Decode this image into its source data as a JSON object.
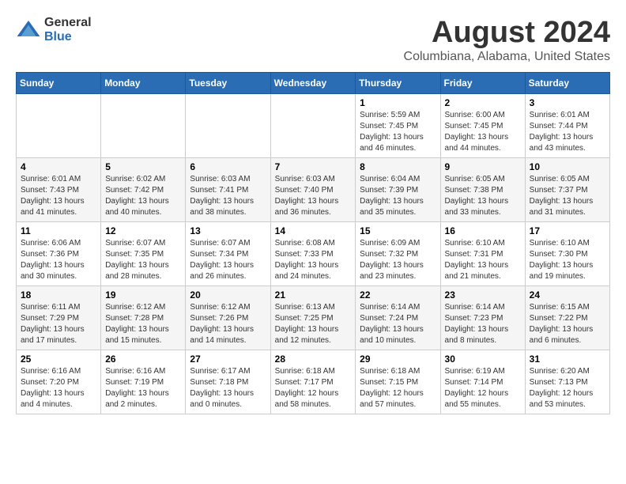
{
  "logo": {
    "general": "General",
    "blue": "Blue"
  },
  "title": "August 2024",
  "subtitle": "Columbiana, Alabama, United States",
  "days_of_week": [
    "Sunday",
    "Monday",
    "Tuesday",
    "Wednesday",
    "Thursday",
    "Friday",
    "Saturday"
  ],
  "weeks": [
    [
      {
        "day": "",
        "info": ""
      },
      {
        "day": "",
        "info": ""
      },
      {
        "day": "",
        "info": ""
      },
      {
        "day": "",
        "info": ""
      },
      {
        "day": "1",
        "sunrise": "5:59 AM",
        "sunset": "7:45 PM",
        "daylight": "13 hours and 46 minutes."
      },
      {
        "day": "2",
        "sunrise": "6:00 AM",
        "sunset": "7:45 PM",
        "daylight": "13 hours and 44 minutes."
      },
      {
        "day": "3",
        "sunrise": "6:01 AM",
        "sunset": "7:44 PM",
        "daylight": "13 hours and 43 minutes."
      }
    ],
    [
      {
        "day": "4",
        "sunrise": "6:01 AM",
        "sunset": "7:43 PM",
        "daylight": "13 hours and 41 minutes."
      },
      {
        "day": "5",
        "sunrise": "6:02 AM",
        "sunset": "7:42 PM",
        "daylight": "13 hours and 40 minutes."
      },
      {
        "day": "6",
        "sunrise": "6:03 AM",
        "sunset": "7:41 PM",
        "daylight": "13 hours and 38 minutes."
      },
      {
        "day": "7",
        "sunrise": "6:03 AM",
        "sunset": "7:40 PM",
        "daylight": "13 hours and 36 minutes."
      },
      {
        "day": "8",
        "sunrise": "6:04 AM",
        "sunset": "7:39 PM",
        "daylight": "13 hours and 35 minutes."
      },
      {
        "day": "9",
        "sunrise": "6:05 AM",
        "sunset": "7:38 PM",
        "daylight": "13 hours and 33 minutes."
      },
      {
        "day": "10",
        "sunrise": "6:05 AM",
        "sunset": "7:37 PM",
        "daylight": "13 hours and 31 minutes."
      }
    ],
    [
      {
        "day": "11",
        "sunrise": "6:06 AM",
        "sunset": "7:36 PM",
        "daylight": "13 hours and 30 minutes."
      },
      {
        "day": "12",
        "sunrise": "6:07 AM",
        "sunset": "7:35 PM",
        "daylight": "13 hours and 28 minutes."
      },
      {
        "day": "13",
        "sunrise": "6:07 AM",
        "sunset": "7:34 PM",
        "daylight": "13 hours and 26 minutes."
      },
      {
        "day": "14",
        "sunrise": "6:08 AM",
        "sunset": "7:33 PM",
        "daylight": "13 hours and 24 minutes."
      },
      {
        "day": "15",
        "sunrise": "6:09 AM",
        "sunset": "7:32 PM",
        "daylight": "13 hours and 23 minutes."
      },
      {
        "day": "16",
        "sunrise": "6:10 AM",
        "sunset": "7:31 PM",
        "daylight": "13 hours and 21 minutes."
      },
      {
        "day": "17",
        "sunrise": "6:10 AM",
        "sunset": "7:30 PM",
        "daylight": "13 hours and 19 minutes."
      }
    ],
    [
      {
        "day": "18",
        "sunrise": "6:11 AM",
        "sunset": "7:29 PM",
        "daylight": "13 hours and 17 minutes."
      },
      {
        "day": "19",
        "sunrise": "6:12 AM",
        "sunset": "7:28 PM",
        "daylight": "13 hours and 15 minutes."
      },
      {
        "day": "20",
        "sunrise": "6:12 AM",
        "sunset": "7:26 PM",
        "daylight": "13 hours and 14 minutes."
      },
      {
        "day": "21",
        "sunrise": "6:13 AM",
        "sunset": "7:25 PM",
        "daylight": "13 hours and 12 minutes."
      },
      {
        "day": "22",
        "sunrise": "6:14 AM",
        "sunset": "7:24 PM",
        "daylight": "13 hours and 10 minutes."
      },
      {
        "day": "23",
        "sunrise": "6:14 AM",
        "sunset": "7:23 PM",
        "daylight": "13 hours and 8 minutes."
      },
      {
        "day": "24",
        "sunrise": "6:15 AM",
        "sunset": "7:22 PM",
        "daylight": "13 hours and 6 minutes."
      }
    ],
    [
      {
        "day": "25",
        "sunrise": "6:16 AM",
        "sunset": "7:20 PM",
        "daylight": "13 hours and 4 minutes."
      },
      {
        "day": "26",
        "sunrise": "6:16 AM",
        "sunset": "7:19 PM",
        "daylight": "13 hours and 2 minutes."
      },
      {
        "day": "27",
        "sunrise": "6:17 AM",
        "sunset": "7:18 PM",
        "daylight": "13 hours and 0 minutes."
      },
      {
        "day": "28",
        "sunrise": "6:18 AM",
        "sunset": "7:17 PM",
        "daylight": "12 hours and 58 minutes."
      },
      {
        "day": "29",
        "sunrise": "6:18 AM",
        "sunset": "7:15 PM",
        "daylight": "12 hours and 57 minutes."
      },
      {
        "day": "30",
        "sunrise": "6:19 AM",
        "sunset": "7:14 PM",
        "daylight": "12 hours and 55 minutes."
      },
      {
        "day": "31",
        "sunrise": "6:20 AM",
        "sunset": "7:13 PM",
        "daylight": "12 hours and 53 minutes."
      }
    ]
  ]
}
